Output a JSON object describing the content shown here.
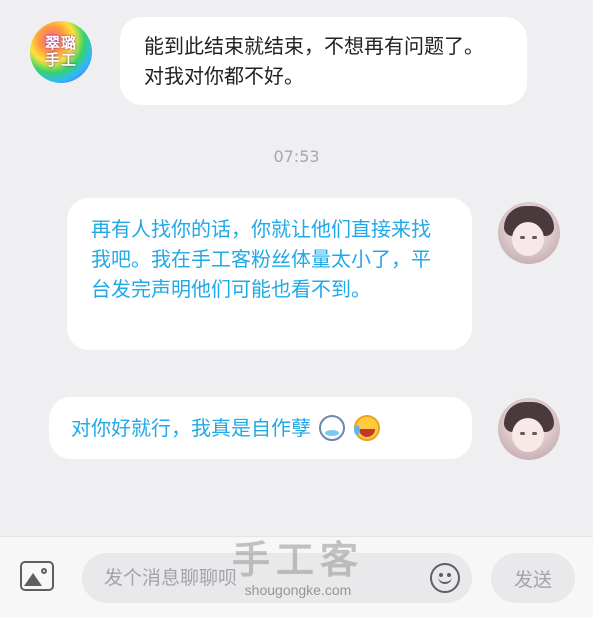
{
  "conversation": {
    "incoming": {
      "avatar_logo_line1": "翠璐",
      "avatar_logo_line2": "手工",
      "text": "能到此结束就结束，不想再有问题了。对我对你都不好。"
    },
    "timestamp": "07:53",
    "outgoing": [
      {
        "text": "再有人找你的话，你就让他们直接来找我吧。我在手工客粉丝体量太小了，平台发完声明他们可能也看不到。"
      },
      {
        "text": "对你好就行，我真是自作孽",
        "emojis": [
          "sad-face-emoji",
          "crying-laughing-emoji"
        ]
      }
    ]
  },
  "input_bar": {
    "image_icon": "image-icon",
    "placeholder": "发个消息聊聊呗",
    "emoji_icon": "smiley-icon",
    "send_label": "发送"
  },
  "watermark": {
    "title": "手工客",
    "url": "shougongke.com"
  },
  "colors": {
    "background": "#efeff1",
    "outgoing_text": "#1fa9e8",
    "incoming_text": "#222222",
    "bubble": "#ffffff"
  }
}
